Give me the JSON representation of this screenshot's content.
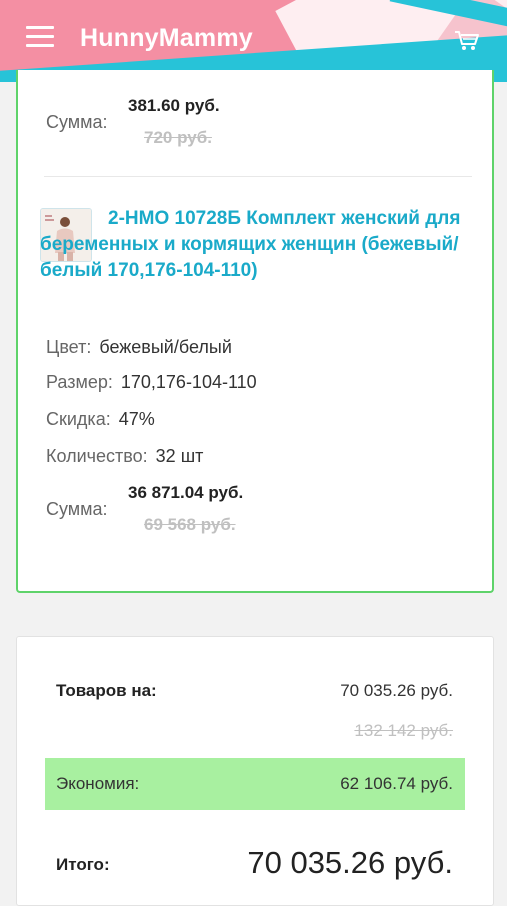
{
  "app": {
    "title": "HunnyMammy"
  },
  "item1": {
    "sum_label": "Сумма:",
    "price_new": "381.60 руб.",
    "price_old": "720 руб."
  },
  "item2": {
    "title": "2-НМО 10728Б Комплект женский для беременных и кормящих женщин (бежевый/белый 170,176-104-110)",
    "color_label": "Цвет:",
    "color_value": "бежевый/белый",
    "size_label": "Размер:",
    "size_value": "170,176-104-110",
    "discount_label": "Скидка:",
    "discount_value": "47%",
    "qty_label": "Количество:",
    "qty_value": "32 шт",
    "sum_label": "Сумма:",
    "price_new": "36 871.04 руб.",
    "price_old": "69 568 руб."
  },
  "summary": {
    "goods_label": "Товаров на:",
    "goods_value": "70 035.26 руб.",
    "goods_old": "132 142 руб.",
    "economy_label": "Экономия:",
    "economy_value": "62 106.74 руб.",
    "total_label": "Итого:",
    "total_value": "70 035.26 руб."
  },
  "colors": {
    "header_pink": "#f48fa3",
    "header_teal": "#27c3d8",
    "title_blue": "#1aaac9",
    "border_green": "#5fd36a",
    "economy_green": "#a8f0a0"
  },
  "icons": {
    "menu": "hamburger-icon",
    "cart": "cart-icon"
  }
}
